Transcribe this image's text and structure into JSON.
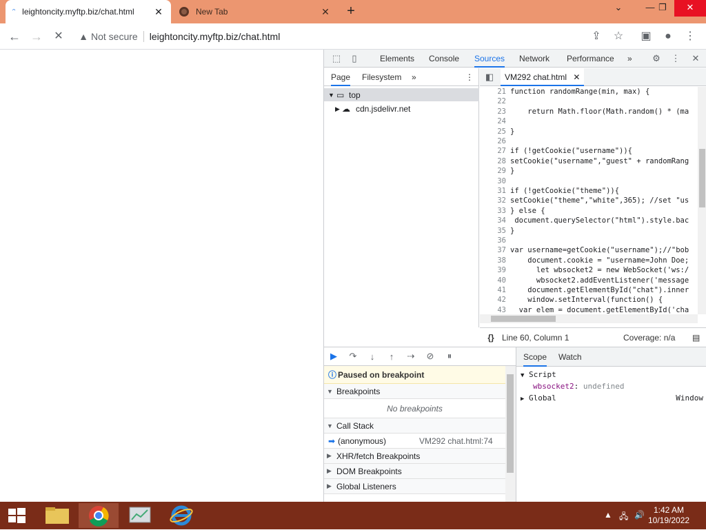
{
  "browser": {
    "tabs": [
      {
        "title": "leightoncity.myftp.biz/chat.html",
        "close": "✕"
      },
      {
        "title": "New Tab",
        "close": "✕"
      }
    ],
    "new_tab": "+",
    "window_controls": {
      "minimize": "⌄",
      "restore": "—",
      "maximize": "❐",
      "close": "✕"
    },
    "address": {
      "security_label": "Not secure",
      "url": "leightoncity.myftp.biz/chat.html"
    }
  },
  "devtools": {
    "tabs": [
      "Elements",
      "Console",
      "Sources",
      "Network",
      "Performance"
    ],
    "more_tabs": "»",
    "navigator": {
      "tabs": [
        "Page",
        "Filesystem"
      ],
      "more": "»",
      "tree": {
        "top": "top",
        "child": "cdn.jsdelivr.net"
      }
    },
    "editor": {
      "file_tab": "VM292 chat.html",
      "lines": [
        {
          "n": "21",
          "code": "function randomRange(min, max) {"
        },
        {
          "n": "22",
          "code": ""
        },
        {
          "n": "23",
          "code": "    return Math.floor(Math.random() * (ma"
        },
        {
          "n": "24",
          "code": ""
        },
        {
          "n": "25",
          "code": "}"
        },
        {
          "n": "26",
          "code": ""
        },
        {
          "n": "27",
          "code": "if (!getCookie(\"username\")){"
        },
        {
          "n": "28",
          "code": "setCookie(\"username\",\"guest\" + randomRang"
        },
        {
          "n": "29",
          "code": "}"
        },
        {
          "n": "30",
          "code": ""
        },
        {
          "n": "31",
          "code": "if (!getCookie(\"theme\")){"
        },
        {
          "n": "32",
          "code": "setCookie(\"theme\",\"white\",365); //set \"us"
        },
        {
          "n": "33",
          "code": "} else {"
        },
        {
          "n": "34",
          "code": " document.querySelector(\"html\").style.bac"
        },
        {
          "n": "35",
          "code": "}"
        },
        {
          "n": "36",
          "code": ""
        },
        {
          "n": "37",
          "code": "var username=getCookie(\"username\");//\"bob"
        },
        {
          "n": "38",
          "code": "    document.cookie = \"username=John Doe;"
        },
        {
          "n": "39",
          "code": "      let wbsocket2 = new WebSocket('ws:/"
        },
        {
          "n": "40",
          "code": "      wbsocket2.addEventListener('message"
        },
        {
          "n": "41",
          "code": "    document.getElementById(\"chat\").inner"
        },
        {
          "n": "42",
          "code": "    window.setInterval(function() {"
        },
        {
          "n": "43",
          "code": "  var elem = document.getElementById('cha"
        }
      ],
      "status_position": "Line 60, Column 1",
      "coverage": "Coverage: n/a",
      "pretty_print": "{}"
    },
    "debugger": {
      "paused_message": "Paused on breakpoint",
      "breakpoints_label": "Breakpoints",
      "no_breakpoints": "No breakpoints",
      "call_stack_label": "Call Stack",
      "frame": {
        "name": "(anonymous)",
        "location": "VM292 chat.html:74"
      },
      "xhr_label": "XHR/fetch Breakpoints",
      "dom_label": "DOM Breakpoints",
      "global_label": "Global Listeners"
    },
    "scope": {
      "tabs": [
        "Scope",
        "Watch"
      ],
      "script_label": "Script",
      "var_name": "wbsocket2",
      "var_value": "undefined",
      "global_label": "Global",
      "global_value": "Window"
    }
  },
  "taskbar": {
    "time": "1:42 AM",
    "date": "10/19/2022"
  }
}
